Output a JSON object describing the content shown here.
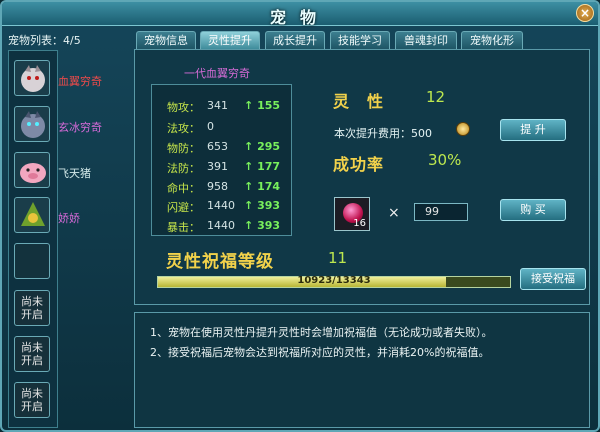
{
  "window": {
    "title": "宠物",
    "close_label": "×"
  },
  "pet_list": {
    "header": "宠物列表：4/5",
    "pets": [
      {
        "name": "血翼穷奇",
        "color": "#ee4a4a"
      },
      {
        "name": "玄冰穷奇",
        "color": "#d66ad8"
      },
      {
        "name": "飞天猪",
        "color": "#d2e8e8"
      },
      {
        "name": "娇娇",
        "color": "#d66ad8"
      }
    ],
    "locked_label": "尚未开启"
  },
  "tabs": [
    {
      "label": "宠物信息",
      "active": false
    },
    {
      "label": "灵性提升",
      "active": true
    },
    {
      "label": "成长提升",
      "active": false
    },
    {
      "label": "技能学习",
      "active": false
    },
    {
      "label": "兽魂封印",
      "active": false
    },
    {
      "label": "宠物化形",
      "active": false
    }
  ],
  "pet_title": "一代血翼穷奇",
  "stats": [
    {
      "label": "物攻：",
      "value": "341",
      "inc": "155"
    },
    {
      "label": "法攻：",
      "value": "0",
      "inc": ""
    },
    {
      "label": "物防：",
      "value": "653",
      "inc": "295"
    },
    {
      "label": "法防：",
      "value": "391",
      "inc": "177"
    },
    {
      "label": "命中：",
      "value": "958",
      "inc": "174"
    },
    {
      "label": "闪避：",
      "value": "1440",
      "inc": "393"
    },
    {
      "label": "暴击：",
      "value": "1440",
      "inc": "393"
    }
  ],
  "spirit": {
    "label": "灵　性",
    "value": "12"
  },
  "cost": {
    "label": "本次提升费用：500"
  },
  "upgrade_button": "提 升",
  "success": {
    "label": "成功率",
    "value": "30%"
  },
  "item": {
    "count": "16",
    "times": "×",
    "quantity": "99"
  },
  "buy_button": "购 买",
  "blessing": {
    "label": "灵性祝福等级",
    "value": "11",
    "progress_text": "10923/13343",
    "current": 10923,
    "max": 13343
  },
  "accept_button": "接受祝福",
  "notes": [
    "1、宠物在使用灵性丹提升灵性时会增加祝福值（无论成功或者失败）。",
    "2、接受祝福后宠物会达到祝福所对应的灵性，并消耗20%的祝福值。"
  ]
}
